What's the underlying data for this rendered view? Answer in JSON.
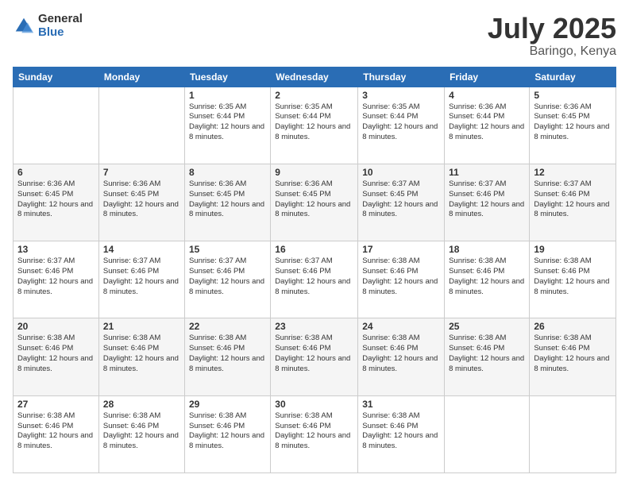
{
  "logo": {
    "general": "General",
    "blue": "Blue"
  },
  "header": {
    "month": "July 2025",
    "location": "Baringo, Kenya"
  },
  "weekdays": [
    "Sunday",
    "Monday",
    "Tuesday",
    "Wednesday",
    "Thursday",
    "Friday",
    "Saturday"
  ],
  "rows": [
    [
      {
        "day": "",
        "info": ""
      },
      {
        "day": "",
        "info": ""
      },
      {
        "day": "1",
        "info": "Sunrise: 6:35 AM\nSunset: 6:44 PM\nDaylight: 12 hours and 8 minutes."
      },
      {
        "day": "2",
        "info": "Sunrise: 6:35 AM\nSunset: 6:44 PM\nDaylight: 12 hours and 8 minutes."
      },
      {
        "day": "3",
        "info": "Sunrise: 6:35 AM\nSunset: 6:44 PM\nDaylight: 12 hours and 8 minutes."
      },
      {
        "day": "4",
        "info": "Sunrise: 6:36 AM\nSunset: 6:44 PM\nDaylight: 12 hours and 8 minutes."
      },
      {
        "day": "5",
        "info": "Sunrise: 6:36 AM\nSunset: 6:45 PM\nDaylight: 12 hours and 8 minutes."
      }
    ],
    [
      {
        "day": "6",
        "info": "Sunrise: 6:36 AM\nSunset: 6:45 PM\nDaylight: 12 hours and 8 minutes."
      },
      {
        "day": "7",
        "info": "Sunrise: 6:36 AM\nSunset: 6:45 PM\nDaylight: 12 hours and 8 minutes."
      },
      {
        "day": "8",
        "info": "Sunrise: 6:36 AM\nSunset: 6:45 PM\nDaylight: 12 hours and 8 minutes."
      },
      {
        "day": "9",
        "info": "Sunrise: 6:36 AM\nSunset: 6:45 PM\nDaylight: 12 hours and 8 minutes."
      },
      {
        "day": "10",
        "info": "Sunrise: 6:37 AM\nSunset: 6:45 PM\nDaylight: 12 hours and 8 minutes."
      },
      {
        "day": "11",
        "info": "Sunrise: 6:37 AM\nSunset: 6:46 PM\nDaylight: 12 hours and 8 minutes."
      },
      {
        "day": "12",
        "info": "Sunrise: 6:37 AM\nSunset: 6:46 PM\nDaylight: 12 hours and 8 minutes."
      }
    ],
    [
      {
        "day": "13",
        "info": "Sunrise: 6:37 AM\nSunset: 6:46 PM\nDaylight: 12 hours and 8 minutes."
      },
      {
        "day": "14",
        "info": "Sunrise: 6:37 AM\nSunset: 6:46 PM\nDaylight: 12 hours and 8 minutes."
      },
      {
        "day": "15",
        "info": "Sunrise: 6:37 AM\nSunset: 6:46 PM\nDaylight: 12 hours and 8 minutes."
      },
      {
        "day": "16",
        "info": "Sunrise: 6:37 AM\nSunset: 6:46 PM\nDaylight: 12 hours and 8 minutes."
      },
      {
        "day": "17",
        "info": "Sunrise: 6:38 AM\nSunset: 6:46 PM\nDaylight: 12 hours and 8 minutes."
      },
      {
        "day": "18",
        "info": "Sunrise: 6:38 AM\nSunset: 6:46 PM\nDaylight: 12 hours and 8 minutes."
      },
      {
        "day": "19",
        "info": "Sunrise: 6:38 AM\nSunset: 6:46 PM\nDaylight: 12 hours and 8 minutes."
      }
    ],
    [
      {
        "day": "20",
        "info": "Sunrise: 6:38 AM\nSunset: 6:46 PM\nDaylight: 12 hours and 8 minutes."
      },
      {
        "day": "21",
        "info": "Sunrise: 6:38 AM\nSunset: 6:46 PM\nDaylight: 12 hours and 8 minutes."
      },
      {
        "day": "22",
        "info": "Sunrise: 6:38 AM\nSunset: 6:46 PM\nDaylight: 12 hours and 8 minutes."
      },
      {
        "day": "23",
        "info": "Sunrise: 6:38 AM\nSunset: 6:46 PM\nDaylight: 12 hours and 8 minutes."
      },
      {
        "day": "24",
        "info": "Sunrise: 6:38 AM\nSunset: 6:46 PM\nDaylight: 12 hours and 8 minutes."
      },
      {
        "day": "25",
        "info": "Sunrise: 6:38 AM\nSunset: 6:46 PM\nDaylight: 12 hours and 8 minutes."
      },
      {
        "day": "26",
        "info": "Sunrise: 6:38 AM\nSunset: 6:46 PM\nDaylight: 12 hours and 8 minutes."
      }
    ],
    [
      {
        "day": "27",
        "info": "Sunrise: 6:38 AM\nSunset: 6:46 PM\nDaylight: 12 hours and 8 minutes."
      },
      {
        "day": "28",
        "info": "Sunrise: 6:38 AM\nSunset: 6:46 PM\nDaylight: 12 hours and 8 minutes."
      },
      {
        "day": "29",
        "info": "Sunrise: 6:38 AM\nSunset: 6:46 PM\nDaylight: 12 hours and 8 minutes."
      },
      {
        "day": "30",
        "info": "Sunrise: 6:38 AM\nSunset: 6:46 PM\nDaylight: 12 hours and 8 minutes."
      },
      {
        "day": "31",
        "info": "Sunrise: 6:38 AM\nSunset: 6:46 PM\nDaylight: 12 hours and 8 minutes."
      },
      {
        "day": "",
        "info": ""
      },
      {
        "day": "",
        "info": ""
      }
    ]
  ]
}
